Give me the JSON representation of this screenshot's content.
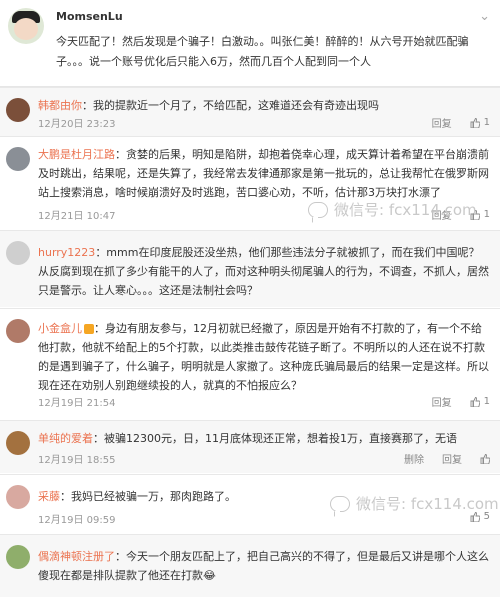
{
  "post": {
    "username": "MomsenLu",
    "text": "今天匹配了！然后发现是个骗子！白激动。。叫张仁美！醉醉的！从六号开始就匹配骗子。。。说一个账号优化后只能入6万，然而几百个人配到同一个人",
    "chevron": "⌄"
  },
  "comments": [
    {
      "user": "韩都由你",
      "text": "：我的提款近一个月了，不给匹配，这难道还会有奇迹出现吗",
      "time": "12月20日 23:23",
      "delete": "",
      "reply": "回复",
      "likes": "1",
      "vip": false
    },
    {
      "user": "大鹏是杜月江路",
      "text": "：贪婪的后果，明知是陷阱，却抱着侥幸心理，成天算计着希望在平台崩溃前及时跳出，结果呢，还是失算了，我经常去发律通那家是第一批玩的，总让我帮忙在俄罗斯网站上搜索消息，啥时候崩溃好及时逃跑，苦口婆心劝，不听，估计那3万块打水漂了",
      "time": "12月21日 10:47",
      "delete": "",
      "reply": "回复",
      "likes": "1",
      "vip": false
    },
    {
      "user": "hurry1223",
      "text": "：mmm在印度屁股还没坐热，他们那些违法分子就被抓了，而在我们中国呢？从反腐到现在抓了多少有能干的人了，而对这种明头彻尾骗人的行为，不调查，不抓人，居然只是警示。让人寒心。。。这还是法制社会吗？",
      "time": "",
      "delete": "",
      "reply": "",
      "likes": "",
      "vip": false
    },
    {
      "user": "小金盒儿",
      "text": "：身边有朋友参与，12月初就已经撤了，原因是开始有不打款的了，有一个不给他打款，他就不给配上的5个打款，以此类推击鼓传花链子断了。不明所以的人还在说不打款的是遇到骗子了，什么骗子，明明就是人家撤了。这种庞氏骗局最后的结果一定是这样。所以现在还在劝别人别跑继续投的人，就真的不怕报应么？",
      "time": "12月19日 21:54",
      "delete": "",
      "reply": "回复",
      "likes": "1",
      "vip": true
    },
    {
      "user": "单纯的爱着",
      "text": "：被骗12300元，日，11月底体现还正常，想着投1万，直接赛那了，无语",
      "time": "12月19日 18:55",
      "delete": "删除",
      "reply": "回复",
      "likes": "",
      "vip": false
    },
    {
      "user": "采藤",
      "text": "：我妈已经被骗一万，那肉跑路了。",
      "time": "12月19日 09:59",
      "delete": "",
      "reply": "",
      "likes": "5",
      "vip": false
    },
    {
      "user": "偶滴神顿注册了",
      "text": "：今天一个朋友匹配上了，把自己高兴的不得了，但是最后又讲是哪个人这么傻现在都是排队提款了他还在打款😂",
      "time": "",
      "delete": "",
      "reply": "",
      "likes": "",
      "vip": false
    }
  ],
  "watermarks": [
    {
      "text": "微信号: fcx114.com"
    },
    {
      "text": "微信号: fcx114.com"
    }
  ],
  "colors": {
    "username_orange": "#eb7350",
    "username_blue": "#507daf",
    "comment_bg": "#f7f7f7"
  }
}
